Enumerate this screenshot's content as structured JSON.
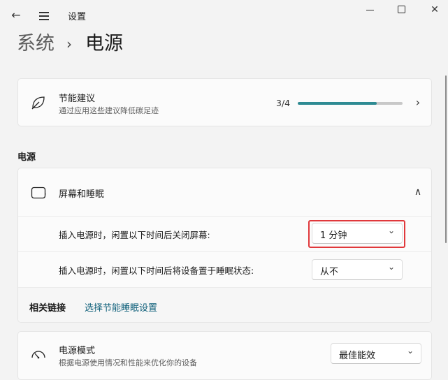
{
  "window": {
    "title": "设置",
    "back_glyph": "←",
    "close_glyph": "✕"
  },
  "breadcrumb": {
    "parent": "系统",
    "separator": "›",
    "current": "电源"
  },
  "energy": {
    "title": "节能建议",
    "subtitle": "通过应用这些建议降低碳足迹",
    "progress_text": "3/4",
    "progress_fraction": 0.75,
    "accent": "#2e8b93",
    "icon": "leaf-icon",
    "chevron": "›"
  },
  "section": {
    "title": "电源"
  },
  "screen_sleep": {
    "title": "屏幕和睡眠",
    "icon": "screen-sleep-icon",
    "chevron": "∧",
    "rows": [
      {
        "label": "插入电源时，闲置以下时间后关闭屏幕:",
        "value": "1 分钟",
        "highlighted": true
      },
      {
        "label": "插入电源时，闲置以下时间后将设备置于睡眠状态:",
        "value": "从不",
        "highlighted": false
      }
    ],
    "dropdown_chevron": "⌄",
    "highlight_color": "#e0383b"
  },
  "related": {
    "title": "相关链接",
    "link": "选择节能睡眠设置",
    "link_color": "#0b5d78"
  },
  "power_mode": {
    "title": "电源模式",
    "subtitle": "根据电源使用情况和性能来优化你的设备",
    "value": "最佳能效",
    "icon": "power-mode-gauge-icon"
  }
}
